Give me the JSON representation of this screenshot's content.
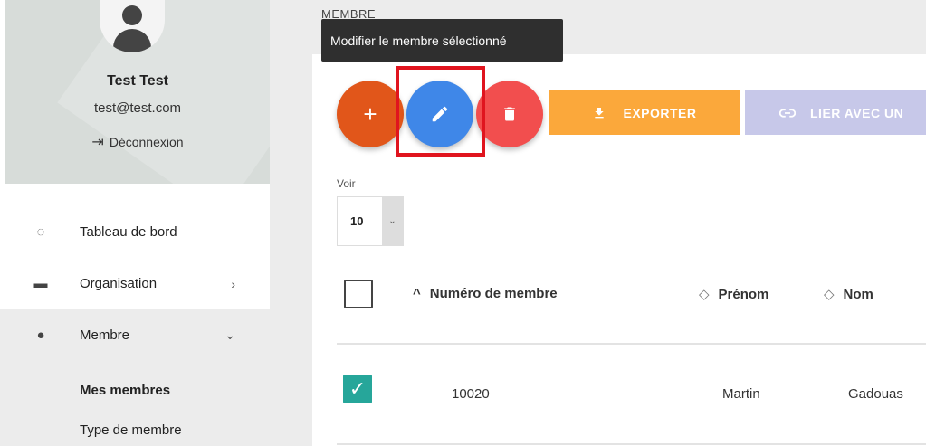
{
  "user": {
    "name": "Test Test",
    "email": "test@test.com",
    "logout_label": "Déconnexion"
  },
  "nav": {
    "dashboard": "Tableau de bord",
    "organisation": "Organisation",
    "membre": "Membre",
    "sub": [
      "Mes membres",
      "Type de membre"
    ]
  },
  "page_title": "MEMBRE",
  "tooltip": "Modifier le membre sélectionné",
  "toolbar": {
    "add_symbol": "+",
    "export_label": "EXPORTER",
    "link_label": "LIER AVEC UN"
  },
  "show": {
    "label": "Voir",
    "value": "10"
  },
  "table": {
    "headers": [
      "Numéro de membre",
      "Prénom",
      "Nom"
    ],
    "rows": [
      {
        "checked": true,
        "numero": "10020",
        "prenom": "Martin",
        "nom": "Gadouas"
      }
    ]
  },
  "colors": {
    "add": "#e1561a",
    "edit": "#3f87e8",
    "delete": "#f24e4e",
    "export": "#fba83b",
    "link": "#c7c8e9",
    "check": "#26a69a",
    "highlight": "#e0141e"
  }
}
